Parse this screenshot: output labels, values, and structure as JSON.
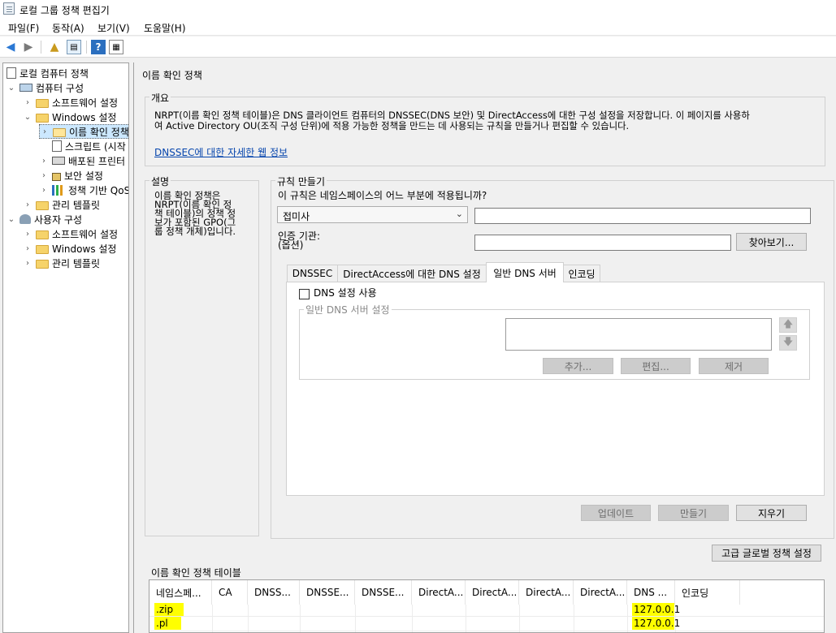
{
  "window": {
    "title": "로컬 그룹 정책 편집기"
  },
  "menu": [
    "파일(F)",
    "동작(A)",
    "보기(V)",
    "도움말(H)"
  ],
  "tree": [
    {
      "label": "로컬 컴퓨터 정책",
      "icon": "policy-doc-icon"
    },
    {
      "label": "컴퓨터 구성",
      "icon": "computer-icon"
    },
    {
      "label": "소프트웨어 설정",
      "icon": "folder-icon"
    },
    {
      "label": "Windows 설정",
      "icon": "folder-icon"
    },
    {
      "label": "이름 확인 정책",
      "icon": "folder-icon"
    },
    {
      "label": "스크립트 (시작",
      "icon": "script-icon"
    },
    {
      "label": "배포된 프린터",
      "icon": "printer-icon"
    },
    {
      "label": "보안 설정",
      "icon": "lock-icon"
    },
    {
      "label": "정책 기반 QoS",
      "icon": "chart-icon"
    },
    {
      "label": "관리 템플릿",
      "icon": "folder-icon"
    },
    {
      "label": "사용자 구성",
      "icon": "users-icon"
    },
    {
      "label": "소프트웨어 설정",
      "icon": "folder-icon"
    },
    {
      "label": "Windows 설정",
      "icon": "folder-icon"
    },
    {
      "label": "관리 템플릿",
      "icon": "folder-icon"
    }
  ],
  "main": {
    "heading": "이름 확인 정책",
    "overview": {
      "title": "개요",
      "text_line1": "NRPT(이름 확인 정책 테이블)은 DNS 클라이언트 컴퓨터의 DNSSEC(DNS 보안) 및 DirectAccess에 대한 구성 설정을 저장합니다. 이 페이지를 사용하",
      "text_line2": "여 Active Directory OU(조직 구성 단위)에 적용 가능한 정책을 만드는 데 사용되는 규칙을 만들거나 편집할 수 있습니다.",
      "link": "DNSSEC에 대한 자세한 웹 정보"
    },
    "description": {
      "title": "설명",
      "line1": "이름 확인 정책은",
      "line2": "NRPT(이름 확인 정",
      "line3": "책 테이블)의 정책 정",
      "line4": "보가 포함된 GPO(그",
      "line5": "룹 정책 개체)입니다."
    },
    "rule": {
      "title": "규칙 만들기",
      "question": "이 규칙은 네임스페이스의 어느 부분에 적용됩니까?",
      "dropdown_value": "접미사",
      "namespace_value": "",
      "cert_label_line1": "인증 기관:",
      "cert_label_line2": "(옵션)",
      "cert_value": "",
      "browse_label": "찾아보기..."
    },
    "tabs": [
      "DNSSEC",
      "DirectAccess에 대한 DNS 설정",
      "일반 DNS 서버",
      "인코딩"
    ],
    "generic_dns": {
      "checkbox_label": "DNS 설정 사용",
      "group_title": "일반 DNS 서버 설정",
      "add_label": "추가...",
      "edit_label": "편집...",
      "remove_label": "제거"
    },
    "actions": {
      "update_label": "업데이트",
      "create_label": "만들기",
      "clear_label": "지우기",
      "advanced_label": "고급 글로벌 정책 설정"
    },
    "nrpt_table": {
      "title": "이름 확인 정책 테이블",
      "columns": [
        "네임스페...",
        "CA",
        "DNSS...",
        "DNSSE...",
        "DNSSE...",
        "DirectA...",
        "DirectA...",
        "DirectA...",
        "DirectA...",
        "DNS ...",
        "인코딩"
      ],
      "rows": [
        {
          "namespace": ".zip",
          "dns": "127.0.0.1"
        },
        {
          "namespace": ".pl",
          "dns": "127.0.0.1"
        }
      ]
    }
  }
}
